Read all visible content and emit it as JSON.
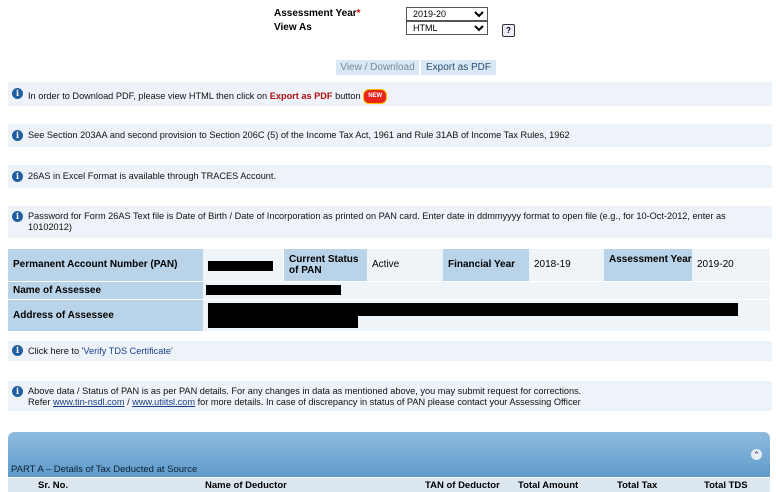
{
  "form": {
    "assessment_year_label": "Assessment Year",
    "required_mark": "*",
    "assessment_year_value": "2019-20",
    "view_as_label": "View As",
    "view_as_value": "HTML",
    "help_glyph": "?"
  },
  "buttons": {
    "view_download": "View / Download",
    "export_pdf": "Export as PDF"
  },
  "notices": {
    "n1_text": "In order to Download PDF, please view HTML then click on",
    "n1_bold": "Export as PDF",
    "n1_after": "button",
    "n1_badge": "NEW",
    "n2": "See Section 203AA and second provision to Section 206C (5) of the Income Tax Act, 1961 and Rule 31AB of Income Tax Rules, 1962",
    "n3": "26AS in Excel Format is available through TRACES Account.",
    "n4": "Password for Form 26AS Text file is Date of Birth / Date of Incorporation as printed on PAN card. Enter date in ddmmyyyy format to open file (e.g., for 10-Oct-2012, enter as 10102012)",
    "n5_prefix": "Click here to",
    "n5_link": "'Verify TDS Certificate'",
    "n6_line1": "Above data / Status of PAN is as per PAN details. For any changes in data as mentioned above, you may submit request for corrections.",
    "n6_refer": "Refer",
    "n6_link1": "www.tin-nsdl.com",
    "n6_sep": "/",
    "n6_link2": "www.utiitsl.com",
    "n6_rest": "for more details. In case of discrepancy in status of PAN please contact your Assessing Officer"
  },
  "details": {
    "pan_label": "Permanent Account Number (PAN)",
    "status_label": "Current Status of PAN",
    "status_value": "Active",
    "fy_label": "Financial Year",
    "fy_value": "2018-19",
    "ay_label": "Assessment Year",
    "ay_value": "2019-20",
    "name_label": "Name of Assessee",
    "address_label": "Address of Assessee"
  },
  "part_a": {
    "title": "PART A – Details of Tax Deducted at Source",
    "collapse_icon": "⌃",
    "columns": [
      "Sr. No.",
      "Name of Deductor",
      "TAN of Deductor",
      "Total Amount",
      "Total Tax",
      "Total TDS"
    ]
  },
  "colors": {
    "header_cell": "#b9d3e8",
    "info_bg": "#edf3f8",
    "info_icon": "#2160a0",
    "part_a_bar": "#6fa7d3"
  }
}
